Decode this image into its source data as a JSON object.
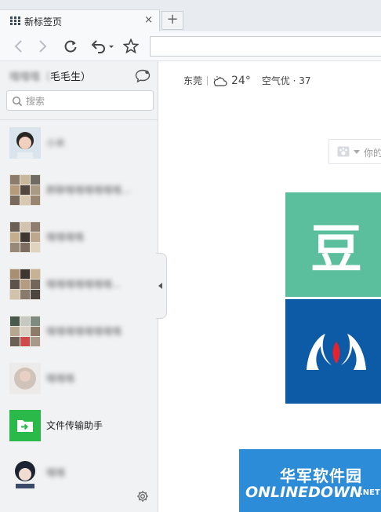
{
  "tab": {
    "title": "新标签页",
    "close": "×",
    "new_tab": "+"
  },
  "toolbar": {
    "back": "back",
    "forward": "forward",
    "reload": "reload",
    "undo": "undo-dropdown",
    "favorite": "star"
  },
  "sidebar": {
    "user_name_blurred": "嘻嘻嘻（",
    "user_name_visible": "毛毛生）",
    "search_placeholder": "搜索",
    "contacts": [
      {
        "name": "小米",
        "blurred": true
      },
      {
        "name": "群聊嘻嘻嘻嘻嘻嘻...",
        "blurred": true
      },
      {
        "name": "嘻嘻嘻嘻",
        "blurred": true
      },
      {
        "name": "嘻嘻嘻嘻嘻嘻嘻...",
        "blurred": true
      },
      {
        "name": "嘻嘻嘻嘻嘻嘻嘻嘻",
        "blurred": true
      },
      {
        "name": "嘻嘻嘻",
        "blurred": true
      },
      {
        "name": "文件传输助手",
        "blurred": false
      },
      {
        "name": "嘻嘻",
        "blurred": true
      }
    ]
  },
  "weather": {
    "city": "东莞",
    "temperature": "24°",
    "air_quality": "空气优 · 37"
  },
  "search_box": {
    "placeholder": "你的"
  },
  "tiles": [
    {
      "label": "豆",
      "color": "#5bbf9e"
    },
    {
      "label": "",
      "color": "#0d5ba7"
    }
  ],
  "watermark": {
    "cn": "华军软件园",
    "en": "ONLINEDOWN",
    "suffix": ".NET"
  },
  "colors": {
    "douban": "#5bbf9e",
    "blue_tile": "#0d5ba7",
    "file_helper": "#2bb94a"
  }
}
